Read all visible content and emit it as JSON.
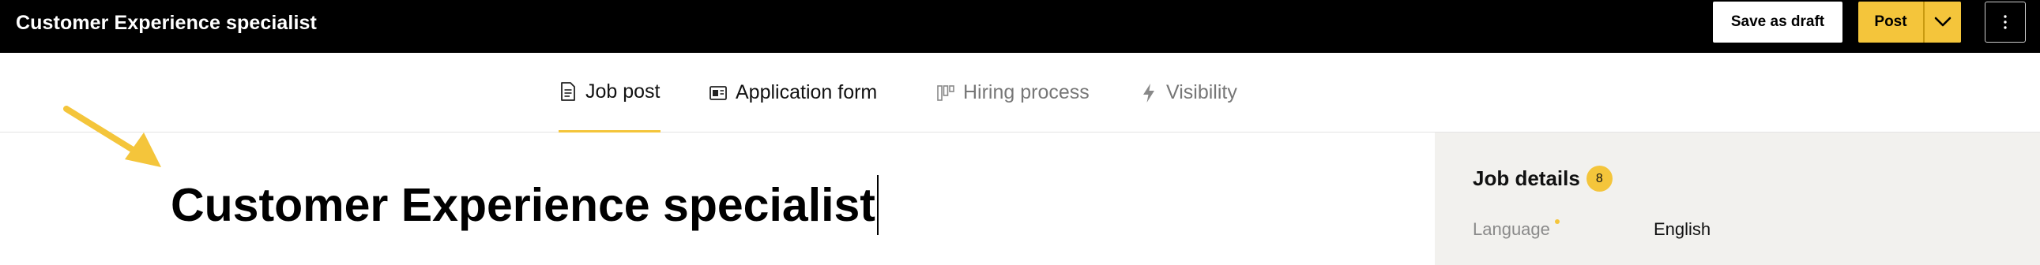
{
  "header": {
    "title": "Customer Experience specialist",
    "save_draft_label": "Save as draft",
    "post_label": "Post",
    "post_dropdown_icon": "chevron-down-icon",
    "more_icon": "vertical-ellipsis-icon"
  },
  "tabs": [
    {
      "label": "Job post",
      "icon": "document-icon",
      "state": "active"
    },
    {
      "label": "Application form",
      "icon": "id-card-icon",
      "state": "default"
    },
    {
      "label": "Hiring process",
      "icon": "pipeline-icon",
      "state": "muted"
    },
    {
      "label": "Visibility",
      "icon": "lightning-icon",
      "state": "muted"
    }
  ],
  "editor": {
    "job_title": "Customer Experience specialist"
  },
  "sidebar": {
    "title": "Job details",
    "badge_count": "8",
    "fields": [
      {
        "label": "Language",
        "required": true,
        "value": "English"
      }
    ]
  },
  "colors": {
    "accent": "#f4c53b",
    "topbar": "#000000",
    "sidebar_bg": "#f2f1ee",
    "muted_text": "#777777"
  }
}
